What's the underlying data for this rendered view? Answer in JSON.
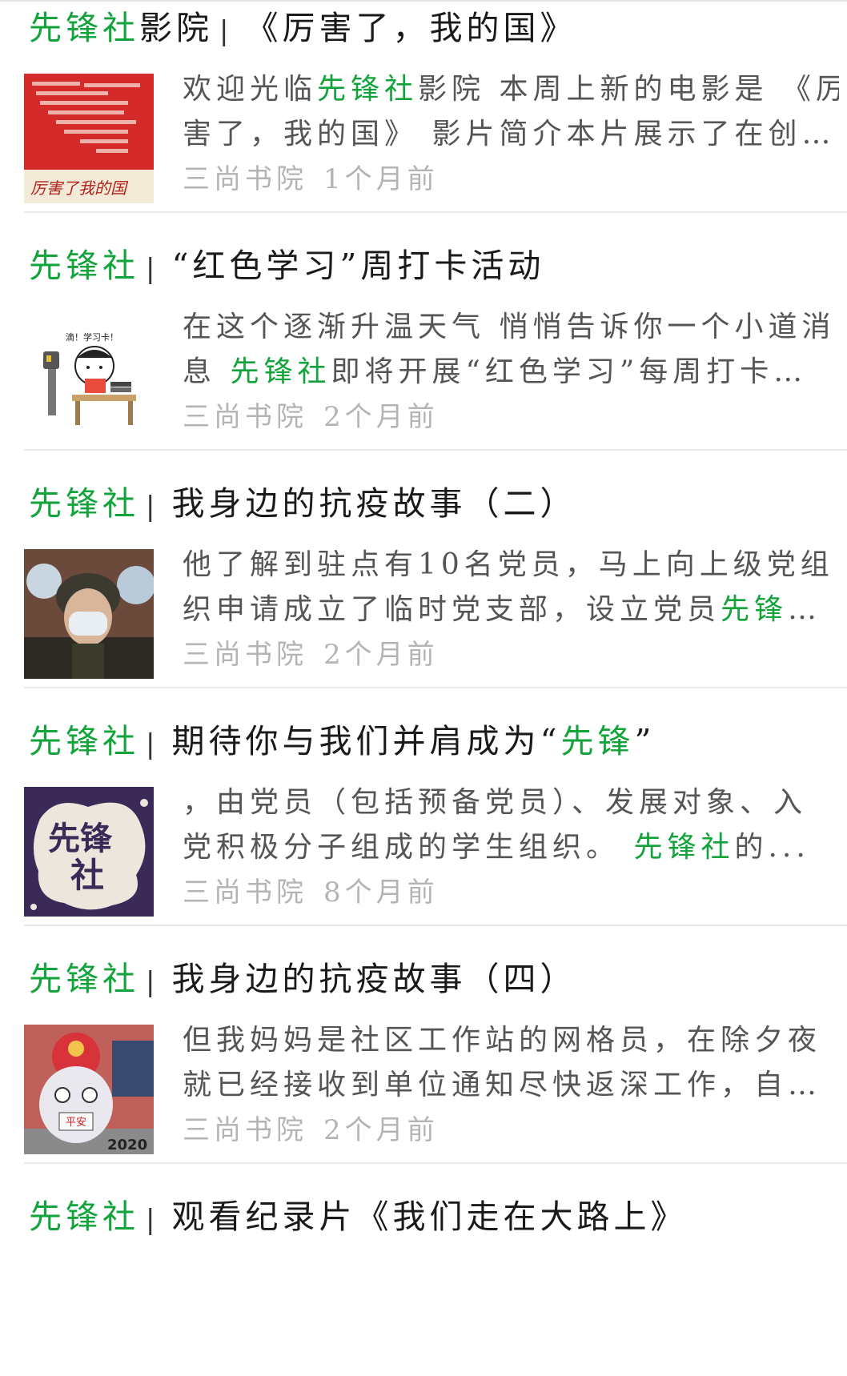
{
  "keyword": "先锋社",
  "items": [
    {
      "title_highlight": "先锋社",
      "title_rest_before_sep": "影院",
      "title_rest": "《厉害了，我的国》",
      "summary_line1_pre": "欢迎光临",
      "summary_line1_hl": "先锋社",
      "summary_line1_post": "影院 本周上新的电影是 《厉",
      "summary_line2": "害了，我的国》 影片简介本片展示了在创…",
      "source": "三尚书院",
      "time": "1个月前",
      "thumb_icon": "movie-poster-icon",
      "thumb_caption": "厉害了我的国"
    },
    {
      "title_highlight": "先锋社",
      "title_rest": "“红色学习”周打卡活动",
      "summary_line1": "在这个逐渐升温天气 悄悄告诉你一个小道消",
      "summary_line2_pre": "息 ",
      "summary_line2_hl": "先锋社",
      "summary_line2_post": "即将开展“红色学习”每周打卡…",
      "source": "三尚书院",
      "time": "2个月前",
      "thumb_icon": "study-cartoon-icon",
      "thumb_caption": "滴！学习卡！"
    },
    {
      "title_highlight": "先锋社",
      "title_rest": "我身边的抗疫故事（二）",
      "summary_line1": "他了解到驻点有10名党员，马上向上级党组",
      "summary_line2_pre": "织申请成立了临时党支部，设立党员",
      "summary_line2_hl": "先锋",
      "summary_line2_post": "…",
      "source": "三尚书院",
      "time": "2个月前",
      "thumb_icon": "masked-soldier-icon"
    },
    {
      "title_highlight": "先锋社",
      "title_rest_pre": "期待你与我们并肩成为“",
      "title_rest_hl": "先锋",
      "title_rest_post": "”",
      "summary_line1": "，由党员（包括预备党员）、发展对象、入",
      "summary_line2_pre": "党积极分子组成的学生组织。 ",
      "summary_line2_hl": "先锋社",
      "summary_line2_post": "的...",
      "source": "三尚书院",
      "time": "8个月前",
      "thumb_icon": "logo-splash-icon",
      "thumb_caption_l1": "先锋",
      "thumb_caption_l2": "社"
    },
    {
      "title_highlight": "先锋社",
      "title_rest": "我身边的抗疫故事（四）",
      "summary_line1": "但我妈妈是社区工作站的网格员，在除夕夜",
      "summary_line2": "就已经接收到单位通知尽快返深工作，自…",
      "source": "三尚书院",
      "time": "2个月前",
      "thumb_icon": "lion-dance-icon",
      "thumb_caption": "平安",
      "thumb_year": "2020"
    },
    {
      "title_highlight": "先锋社",
      "title_rest": "观看纪录片《我们走在大路上》"
    }
  ],
  "separator": "|",
  "colors": {
    "highlight": "#12a33a",
    "meta": "#b4b4b4",
    "summary": "#555555",
    "divider": "#e8e8e8"
  }
}
